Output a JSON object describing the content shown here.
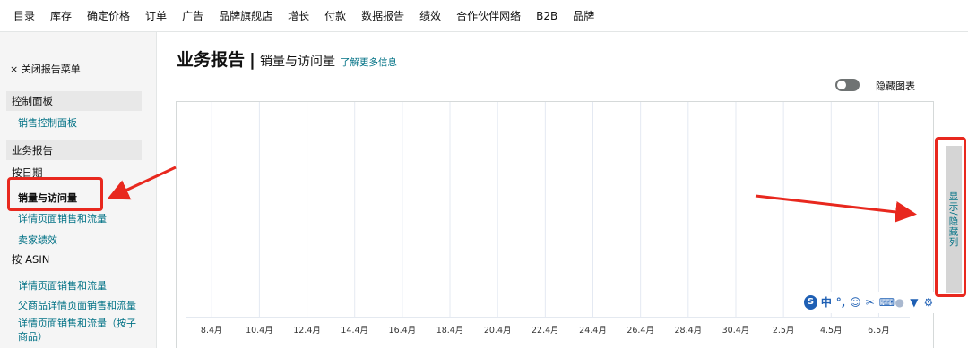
{
  "topnav": {
    "items": [
      {
        "label": "目录"
      },
      {
        "label": "库存"
      },
      {
        "label": "确定价格"
      },
      {
        "label": "订单"
      },
      {
        "label": "广告"
      },
      {
        "label": "品牌旗舰店"
      },
      {
        "label": "增长"
      },
      {
        "label": "付款"
      },
      {
        "label": "数据报告"
      },
      {
        "label": "绩效"
      },
      {
        "label": "合作伙伴网络"
      },
      {
        "label": "B2B"
      },
      {
        "label": "品牌"
      }
    ]
  },
  "sidebar": {
    "close_label": "× 关闭报告菜单",
    "section_dashboard": "控制面板",
    "link_sales_dashboard": "销售控制面板",
    "section_business_reports": "业务报告",
    "group_by_date": "按日期",
    "link_sales_traffic": "销量与访问量",
    "link_detail_page_sales": "详情页面销售和流量",
    "link_seller_performance": "卖家绩效",
    "group_by_asin": "按 ASIN",
    "link_detail_page_sales_asin": "详情页面销售和流量",
    "link_parent_item_detail": "父商品详情页面销售和流量",
    "link_detail_by_child": "详情页面销售和流量（按子商品）"
  },
  "header": {
    "title": "业务报告",
    "separator": "|",
    "subtitle": "销量与访问量",
    "learn_more": "了解更多信息"
  },
  "controls": {
    "hide_chart_label": "隐藏图表",
    "hide_chart_on": false,
    "show_hide_columns": "显示/隐藏列"
  },
  "chart_data": {
    "type": "line",
    "categories": [
      "8.4月",
      "10.4月",
      "12.4月",
      "14.4月",
      "16.4月",
      "18.4月",
      "20.4月",
      "22.4月",
      "24.4月",
      "26.4月",
      "28.4月",
      "30.4月",
      "2.5月",
      "4.5月",
      "6.5月"
    ],
    "series": [],
    "grid": true
  },
  "ime_toolbar": {
    "items": [
      {
        "icon": "sogou-logo-icon",
        "glyph": "S"
      },
      {
        "icon": "chinese-mode-icon",
        "glyph": "中"
      },
      {
        "icon": "punctuation-icon",
        "glyph": "°,"
      },
      {
        "icon": "emoji-icon",
        "glyph": "☺"
      },
      {
        "icon": "scissors-icon",
        "glyph": "✂"
      },
      {
        "icon": "keyboard-icon",
        "glyph": "⌨"
      },
      {
        "icon": "user-icon",
        "glyph": "👤"
      },
      {
        "icon": "shirt-icon",
        "glyph": "👕"
      },
      {
        "icon": "gear-icon",
        "glyph": "⚙"
      }
    ]
  },
  "colors": {
    "link": "#007185",
    "annotation_red": "#e8281e",
    "ime_blue": "#1e5fb4"
  }
}
